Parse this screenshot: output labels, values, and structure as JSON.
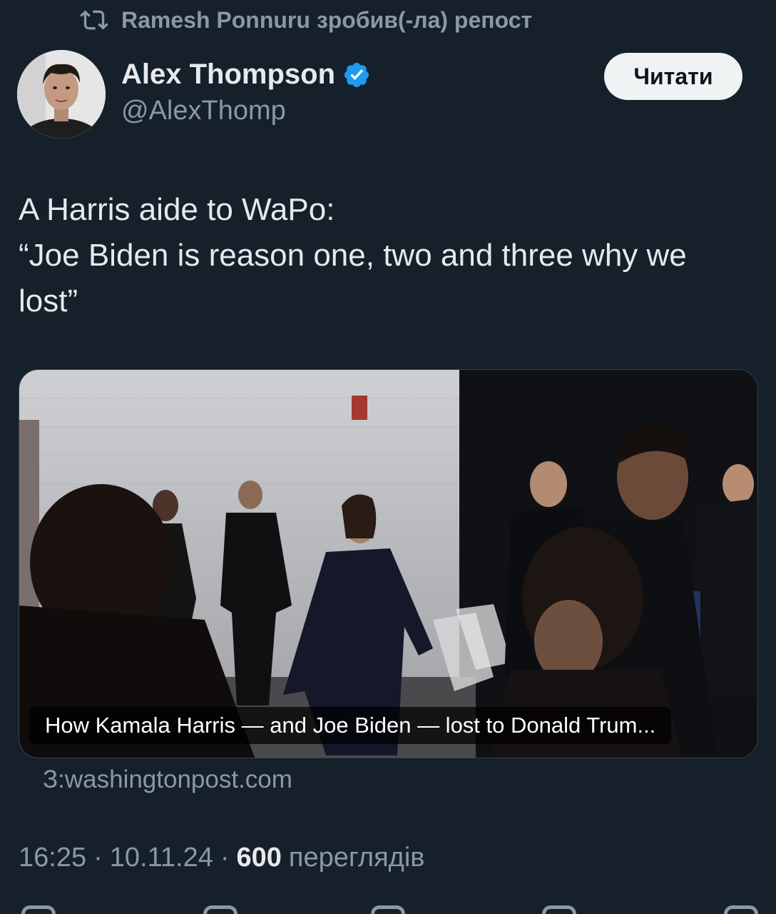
{
  "repost": {
    "text": "Ramesh Ponnuru зробив(-ла) репост",
    "icon": "repost-icon"
  },
  "author": {
    "name": "Alex Thompson",
    "handle": "@AlexThomp",
    "verified_icon": "verified-badge-icon",
    "verified_color": "#1d9bf0"
  },
  "follow_button": {
    "label": "Читати"
  },
  "tweet": {
    "lines": [
      "A Harris aide to WaPo:",
      "“Joe Biden is reason one, two and three why we",
      "lost”"
    ]
  },
  "card": {
    "title": "How Kamala Harris — and Joe Biden — lost to Donald Trum...",
    "domain": "З:washingtonpost.com"
  },
  "meta": {
    "time": "16:25",
    "date": "10.11.24",
    "views_count": "600",
    "views_label": "переглядів"
  },
  "colors": {
    "background": "#15202b",
    "text_primary": "#e7e9ea",
    "text_secondary": "#8b98a5",
    "button_bg": "#eff3f4"
  }
}
